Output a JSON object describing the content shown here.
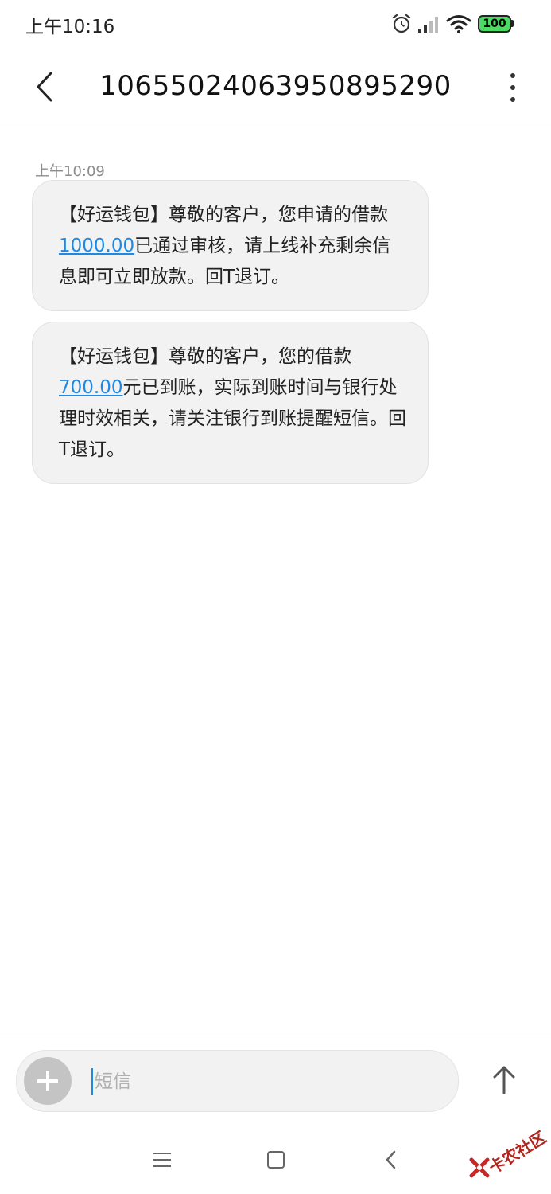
{
  "status_bar": {
    "time": "上午10:16",
    "battery": "100",
    "icons": [
      "alarm-icon",
      "signal-icon",
      "wifi-icon",
      "battery-icon"
    ]
  },
  "header": {
    "title": "10655024063950895290",
    "back_icon": "chevron-left-icon",
    "more_icon": "more-vertical-icon"
  },
  "conversation": {
    "timestamp": "上午10:09",
    "messages": [
      {
        "text_before": "【好运钱包】尊敬的客户，您申请的借款",
        "amount": "1000.00",
        "text_after": "已通过审核，请上线补充剩余信息即可立即放款。回T退订。"
      },
      {
        "text_before": "【好运钱包】尊敬的客户，您的借款",
        "amount": "700.00",
        "text_after": "元已到账，实际到账时间与银行处理时效相关，请关注银行到账提醒短信。回T退订。"
      }
    ]
  },
  "compose": {
    "placeholder": "短信",
    "add_icon": "plus-icon",
    "send_icon": "arrow-up-icon"
  },
  "navigation": {
    "icons": [
      "menu-icon",
      "home-square-icon",
      "back-chevron-icon"
    ]
  },
  "watermark": {
    "text": "卡农社区"
  },
  "colors": {
    "accent": "#1e88e5",
    "bubble": "#f2f2f2",
    "battery": "#4cd964"
  }
}
